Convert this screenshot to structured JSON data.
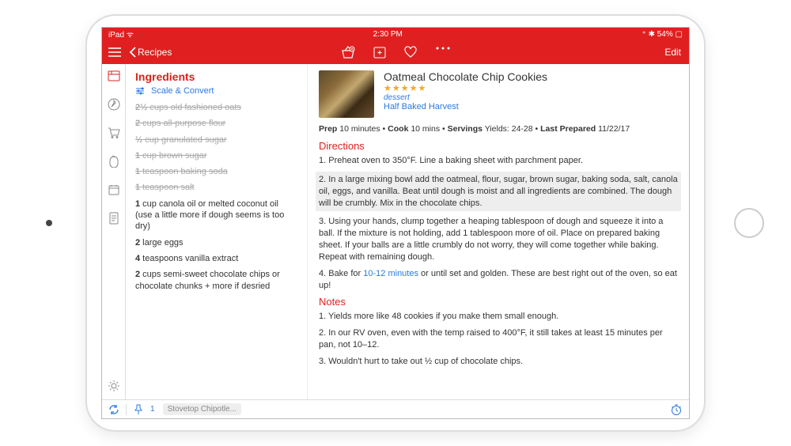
{
  "status_bar": {
    "left": "iPad ᯤ",
    "center": "2:30 PM",
    "right": "⁺ ✱ 54% ▢"
  },
  "nav": {
    "back_label": "Recipes",
    "edit_label": "Edit"
  },
  "ingredients": {
    "heading": "Ingredients",
    "scale_label": "Scale & Convert",
    "items": [
      {
        "amount": "2½",
        "text": "cups old fashioned oats",
        "struck": true
      },
      {
        "amount": "2",
        "text": "cups all-purpose flour",
        "struck": true
      },
      {
        "amount": "½",
        "text": "cup granulated sugar",
        "struck": true
      },
      {
        "amount": "1",
        "text": "cup brown sugar",
        "struck": true
      },
      {
        "amount": "1",
        "text": "teaspoon baking soda",
        "struck": true
      },
      {
        "amount": "1",
        "text": "teaspoon salt",
        "struck": true
      },
      {
        "amount": "1",
        "text": "cup canola oil or melted coconut oil (use a little more if dough seems is too dry)",
        "struck": false
      },
      {
        "amount": "2",
        "text": "large eggs",
        "struck": false
      },
      {
        "amount": "4",
        "text": "teaspoons vanilla extract",
        "struck": false
      },
      {
        "amount": "2",
        "text": "cups semi-sweet chocolate chips or chocolate chunks + more if desried",
        "struck": false
      }
    ]
  },
  "recipe": {
    "title": "Oatmeal Chocolate Chip Cookies",
    "stars": "★★★★★",
    "tag": "dessert",
    "source": "Half Baked Harvest",
    "meta": {
      "prep_label": "Prep",
      "prep": "10 minutes",
      "cook_label": "Cook",
      "cook": "10 mins",
      "servings_label": "Servings",
      "servings": "Yields: 24-28",
      "last_label": "Last Prepared",
      "last": "11/22/17"
    },
    "directions_heading": "Directions",
    "directions": [
      "1. Preheat oven to 350°F. Line a baking sheet with parchment paper.",
      "2. In a large mixing bowl add the oatmeal, flour, sugar, brown sugar, baking soda, salt, canola oil, eggs, and vanilla. Beat until dough is moist and all ingredients are combined. The dough will be crumbly. Mix in the chocolate chips.",
      "3. Using your hands, clump together a heaping tablespoon of dough and squeeze it into a ball. If the mixture is not holding, add 1 tablespoon more of oil. Place on prepared baking sheet. If your balls are a little crumbly do not worry, they will come together while baking. Repeat with remaining dough.",
      "4. Bake for |10-12 minutes| or until set and golden. These are best right out of the oven, so eat up!"
    ],
    "notes_heading": "Notes",
    "notes": [
      "1. Yields more like 48 cookies if you make them small enough.",
      "2. In our RV oven, even with the temp raised to 400°F, it still takes at least 15 minutes per pan, not 10–12.",
      "3. Wouldn't hurt to take out ½ cup of chocolate chips."
    ]
  },
  "bottom_bar": {
    "pin_count": "1",
    "chip_label": "Stovetop Chipotle..."
  }
}
